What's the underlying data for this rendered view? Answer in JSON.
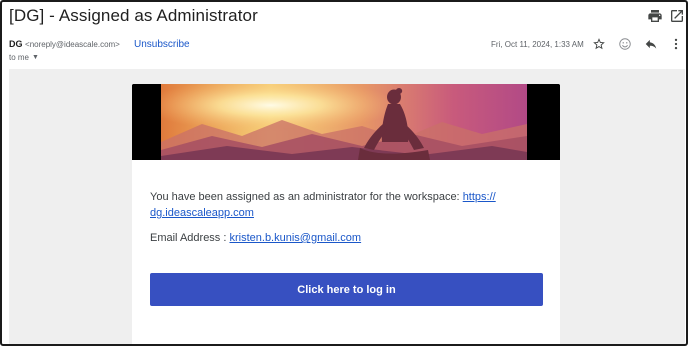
{
  "email": {
    "subject": "[DG] - Assigned as Administrator",
    "sender_name": "DG",
    "sender_email": "<noreply@ideascale.com>",
    "unsubscribe_label": "Unsubscribe",
    "recipient_label": "to me",
    "date": "Fri, Oct 11, 2024, 1:33 AM"
  },
  "icons": {
    "print": "print-icon",
    "open_new_window": "open-in-new-window-icon",
    "star": "star-icon",
    "emoji": "emoji-reaction-icon",
    "reply": "reply-icon",
    "more": "more-vert-icon"
  },
  "message": {
    "assigned_text": "You have been assigned as an administrator for the workspace: ",
    "workspace_link_line1": "https://",
    "workspace_link_line2": "dg.ideascaleapp.com",
    "email_address_label": "Email Address : ",
    "email_address": "kristen.b.kunis@gmail.com",
    "login_button": "Click here to log in"
  },
  "colors": {
    "link": "#1a57c9",
    "button_bg": "#3750c1",
    "page_bg": "#efefef"
  }
}
